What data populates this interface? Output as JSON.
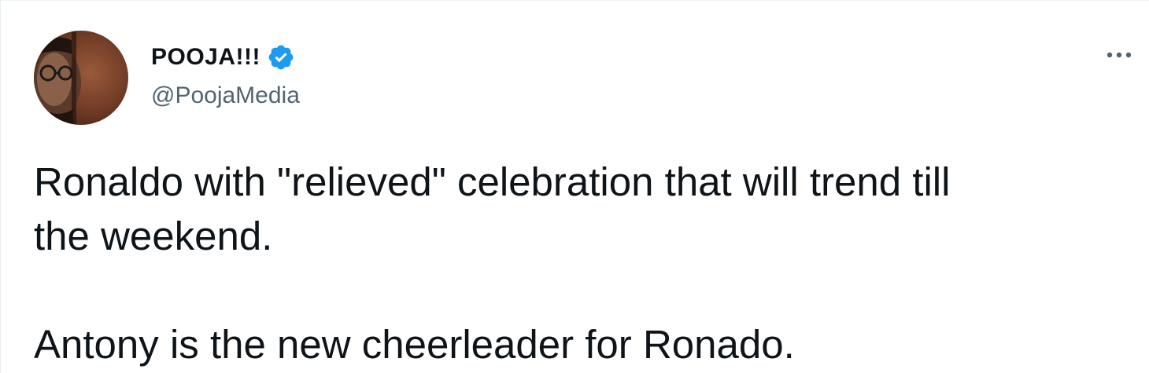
{
  "tweet": {
    "author": {
      "display_name": "POOJA!!!",
      "handle": "@PoojaMedia",
      "verified": true,
      "avatar_icon": "user-avatar"
    },
    "menu_icon": "more-horizontal-icon",
    "text": {
      "paragraph1_line1": "Ronaldo with \"relieved\" celebration that will trend till",
      "paragraph1_line2": "the weekend.",
      "paragraph2": "Antony is the new cheerleader for Ronado."
    }
  },
  "colors": {
    "verified_blue": "#1d9bf0",
    "handle_gray": "#536471",
    "text": "#0f1419"
  }
}
